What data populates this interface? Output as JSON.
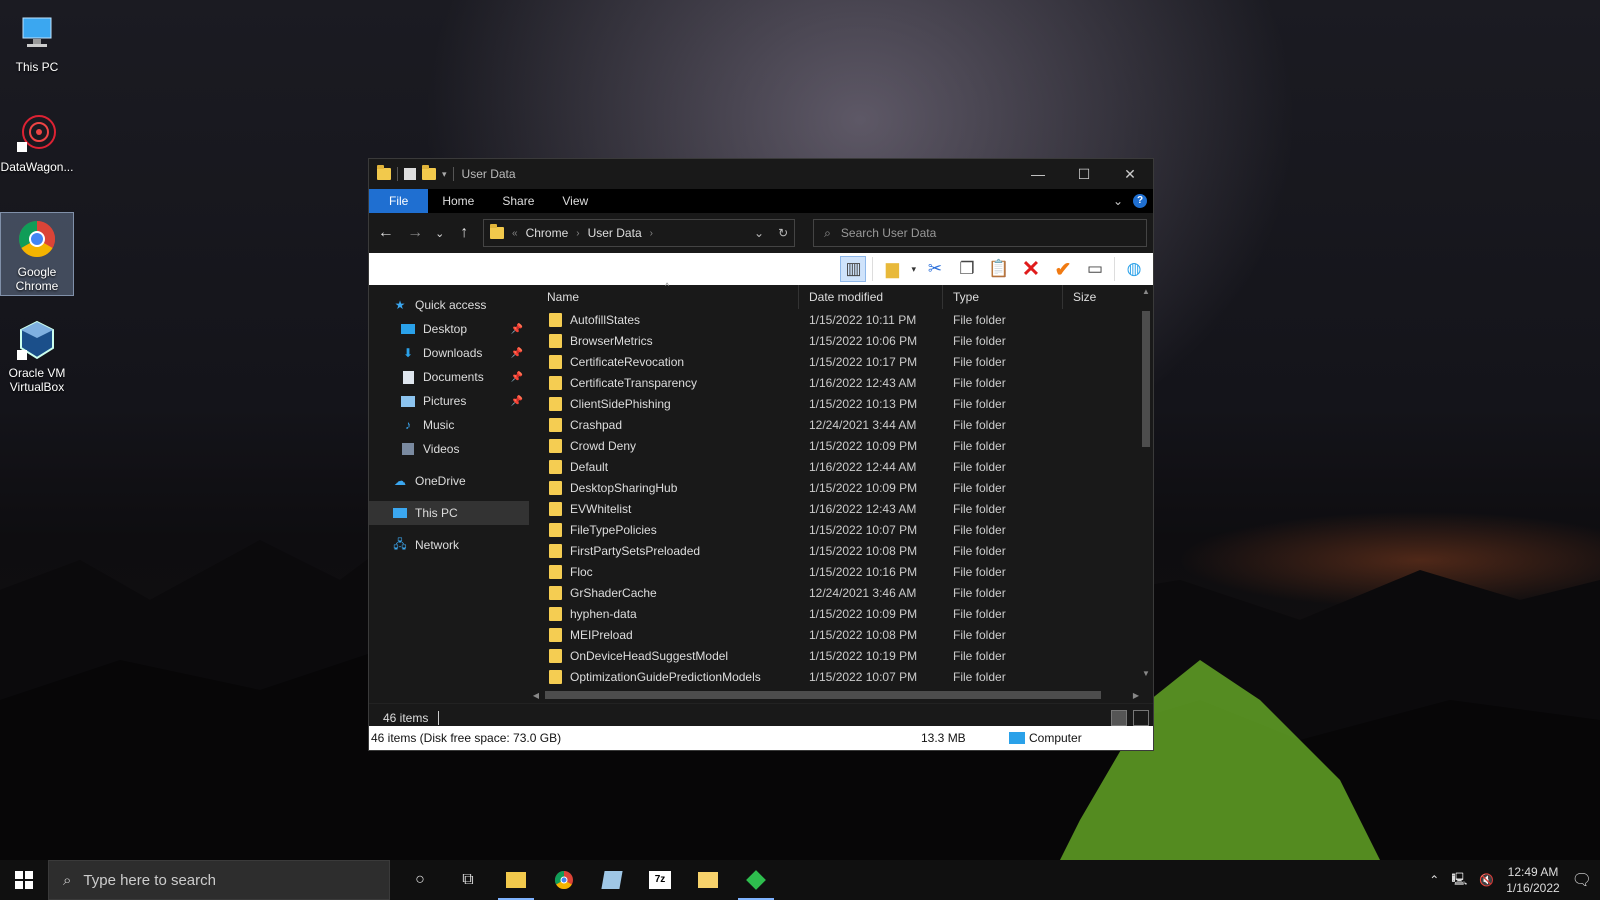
{
  "desktop": {
    "icons": [
      {
        "label": "This PC"
      },
      {
        "label": "DataWagon..."
      },
      {
        "label": "Google\nChrome"
      },
      {
        "label": "Oracle VM\nVirtualBox"
      }
    ]
  },
  "window": {
    "title": "User Data",
    "tabs": [
      "File",
      "Home",
      "Share",
      "View"
    ],
    "address": {
      "crumbs": [
        "Chrome",
        "User Data"
      ]
    },
    "search_placeholder": "Search User Data",
    "columns": {
      "name": "Name",
      "date": "Date modified",
      "type": "Type",
      "size": "Size"
    },
    "nav": {
      "quick_access": "Quick access",
      "desktop": "Desktop",
      "downloads": "Downloads",
      "documents": "Documents",
      "pictures": "Pictures",
      "music": "Music",
      "videos": "Videos",
      "onedrive": "OneDrive",
      "this_pc": "This PC",
      "network": "Network"
    },
    "files": [
      {
        "name": "AutofillStates",
        "date": "1/15/2022 10:11 PM",
        "type": "File folder"
      },
      {
        "name": "BrowserMetrics",
        "date": "1/15/2022 10:06 PM",
        "type": "File folder"
      },
      {
        "name": "CertificateRevocation",
        "date": "1/15/2022 10:17 PM",
        "type": "File folder"
      },
      {
        "name": "CertificateTransparency",
        "date": "1/16/2022 12:43 AM",
        "type": "File folder"
      },
      {
        "name": "ClientSidePhishing",
        "date": "1/15/2022 10:13 PM",
        "type": "File folder"
      },
      {
        "name": "Crashpad",
        "date": "12/24/2021 3:44 AM",
        "type": "File folder"
      },
      {
        "name": "Crowd Deny",
        "date": "1/15/2022 10:09 PM",
        "type": "File folder"
      },
      {
        "name": "Default",
        "date": "1/16/2022 12:44 AM",
        "type": "File folder"
      },
      {
        "name": "DesktopSharingHub",
        "date": "1/15/2022 10:09 PM",
        "type": "File folder"
      },
      {
        "name": "EVWhitelist",
        "date": "1/16/2022 12:43 AM",
        "type": "File folder"
      },
      {
        "name": "FileTypePolicies",
        "date": "1/15/2022 10:07 PM",
        "type": "File folder"
      },
      {
        "name": "FirstPartySetsPreloaded",
        "date": "1/15/2022 10:08 PM",
        "type": "File folder"
      },
      {
        "name": "Floc",
        "date": "1/15/2022 10:16 PM",
        "type": "File folder"
      },
      {
        "name": "GrShaderCache",
        "date": "12/24/2021 3:46 AM",
        "type": "File folder"
      },
      {
        "name": "hyphen-data",
        "date": "1/15/2022 10:09 PM",
        "type": "File folder"
      },
      {
        "name": "MEIPreload",
        "date": "1/15/2022 10:08 PM",
        "type": "File folder"
      },
      {
        "name": "OnDeviceHeadSuggestModel",
        "date": "1/15/2022 10:19 PM",
        "type": "File folder"
      },
      {
        "name": "OptimizationGuidePredictionModels",
        "date": "1/15/2022 10:07 PM",
        "type": "File folder"
      }
    ],
    "status": {
      "items": "46 items"
    },
    "infobar": {
      "left": "46 items (Disk free space: 73.0 GB)",
      "size": "13.3 MB",
      "location": "Computer"
    }
  },
  "taskbar": {
    "search_placeholder": "Type here to search",
    "time": "12:49 AM",
    "date": "1/16/2022"
  },
  "colors": {
    "accent": "#1f6fd1",
    "folder": "#f5cd52",
    "delete": "#e01b1b"
  }
}
